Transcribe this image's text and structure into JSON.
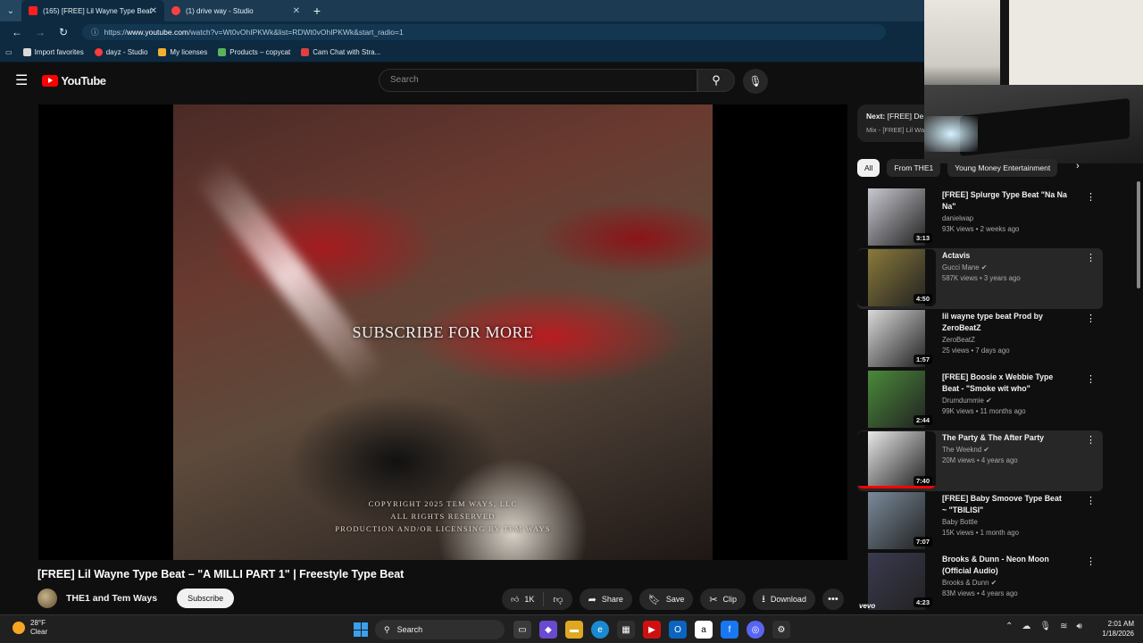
{
  "browser": {
    "tabs": [
      {
        "label": "(165) [FREE] Lil Wayne Type Beat",
        "active": true,
        "color": "#ff2020"
      },
      {
        "label": "(1) drive way - Studio",
        "active": false,
        "color": "#ff4040"
      }
    ],
    "new_tab": "+",
    "url_prefix": "https://",
    "url_host": "www.youtube.com",
    "url_rest": "/watch?v=Wt0vOhIPKWk&list=RDWt0vOhIPKWk&start_radio=1",
    "bookmarks": [
      {
        "label": "Import favorites",
        "color": "#d9d9d9"
      },
      {
        "label": "dayz - Studio",
        "color": "#ff3b3b"
      },
      {
        "label": "My licenses",
        "color": "#f0b030"
      },
      {
        "label": "Products – copycat",
        "color": "#59b35a"
      },
      {
        "label": "Cam Chat with Stra...",
        "color": "#e04040"
      }
    ]
  },
  "youtube": {
    "logo": "YouTube",
    "search_placeholder": "Search",
    "video": {
      "overlay_title": "SUBSCRIBE FOR MORE",
      "copyright_lines": [
        "COPYRIGHT 2025 TEM WAYS, LLC",
        "ALL RIGHTS RESERVED",
        "PRODUCTION AND/OR LICENSING BY TEM WAYS"
      ],
      "title": "[FREE] Lil Wayne Type Beat – \"A MILLI PART 1\" | Freestyle Type Beat",
      "channel": "THE1 and Tem Ways",
      "subscribe": "Subscribe",
      "likes": "1K",
      "share": "Share",
      "save": "Save",
      "clip": "Clip",
      "download": "Download"
    },
    "next": {
      "label": "Next:",
      "title": "[FREE] De",
      "sub": "Mix - [FREE] Lil Wa"
    },
    "chips": [
      "All",
      "From THE1",
      "Young Money Entertainment"
    ],
    "recommendations": [
      {
        "title": "[FREE] Splurge Type Beat \"Na Na Na\"",
        "channel": "danielwap",
        "meta": "93K views • 2 weeks ago",
        "duration": "3:13",
        "thumb": "#c8c8d0",
        "verified": false,
        "highlight": false,
        "progress": 0
      },
      {
        "title": "Actavis",
        "channel": "Gucci Mane",
        "meta": "587K views • 3 years ago",
        "duration": "4:50",
        "thumb": "#8a7a3a",
        "verified": true,
        "highlight": true,
        "progress": 0
      },
      {
        "title": "lil wayne type beat Prod by ZeroBeatZ",
        "channel": "ZeroBeatZ",
        "meta": "25 views • 7 days ago",
        "duration": "1:57",
        "thumb": "#d9d9d9",
        "verified": false,
        "highlight": false,
        "progress": 0
      },
      {
        "title": "[FREE] Boosie x Webbie Type Beat - \"Smoke wit who\"",
        "channel": "Drumdummie",
        "meta": "99K views • 11 months ago",
        "duration": "2:44",
        "thumb": "#4a8a3a",
        "verified": true,
        "highlight": false,
        "progress": 0
      },
      {
        "title": "The Party & The After Party",
        "channel": "The Weeknd",
        "meta": "20M views • 4 years ago",
        "duration": "7:40",
        "thumb": "#e8e8e8",
        "verified": true,
        "highlight": true,
        "progress": 1
      },
      {
        "title": "[FREE] Baby Smoove Type Beat ~ \"TBILISI\"",
        "channel": "Baby Bottle",
        "meta": "15K views • 1 month ago",
        "duration": "7:07",
        "thumb": "#7a8a9a",
        "verified": false,
        "highlight": false,
        "progress": 0
      },
      {
        "title": "Brooks & Dunn - Neon Moon (Official Audio)",
        "channel": "Brooks & Dunn",
        "meta": "83M views • 4 years ago",
        "duration": "4:23",
        "thumb": "#3a3a50",
        "verified": true,
        "highlight": false,
        "progress": 0
      }
    ],
    "vevo": "vevo"
  },
  "taskbar": {
    "temp": "28°F",
    "cond": "Clear",
    "search": "Search",
    "time": "2:01 AM",
    "date": "1/18/2026"
  }
}
